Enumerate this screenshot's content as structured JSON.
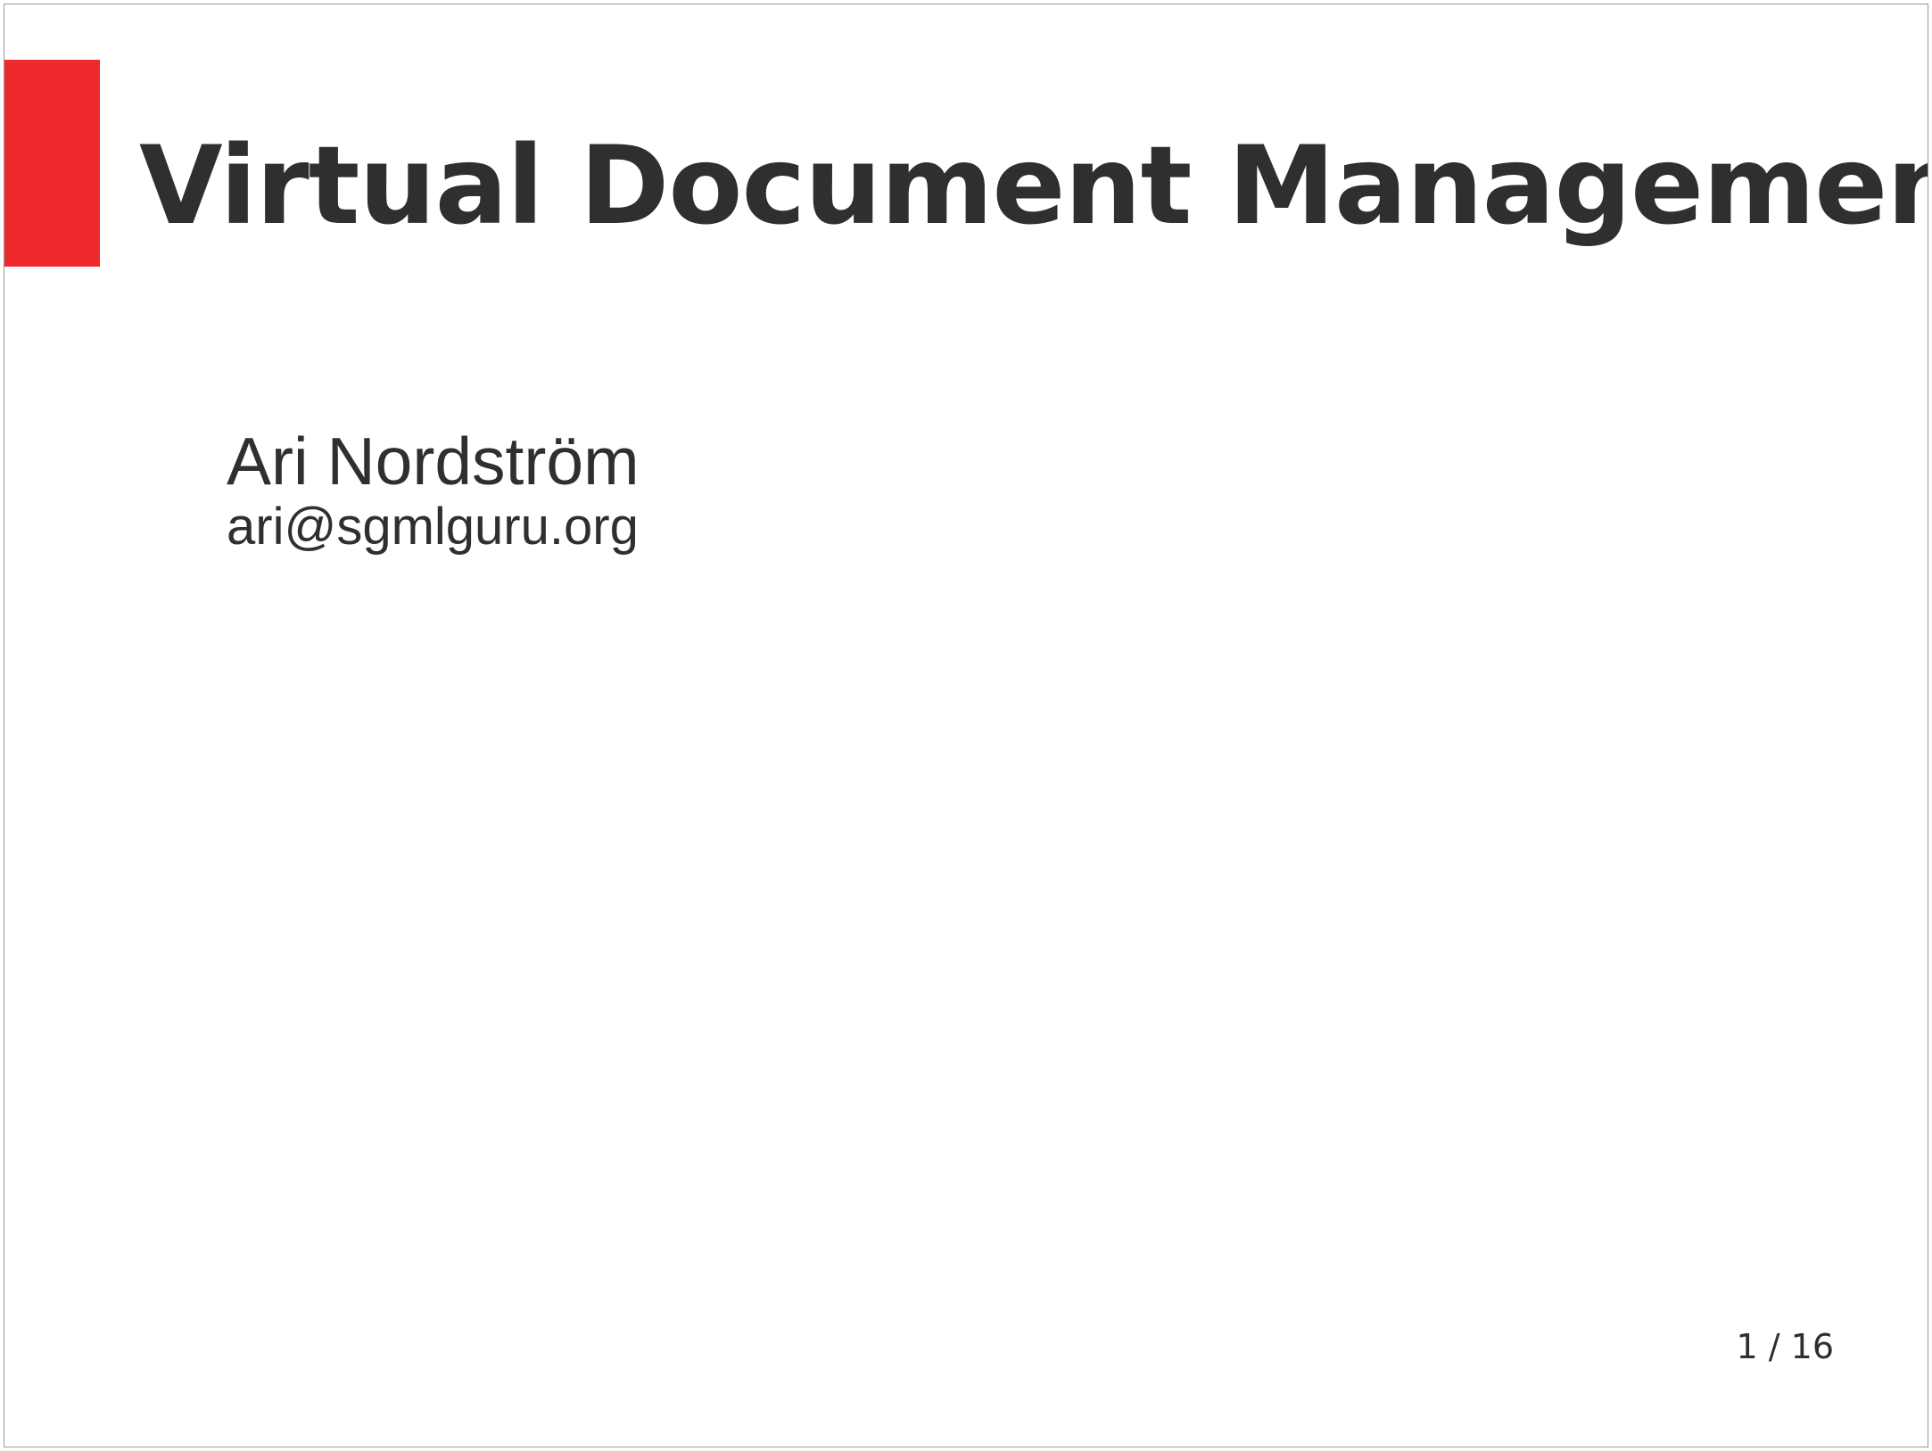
{
  "slide": {
    "title": "Virtual Document Management",
    "author": "Ari Nordström",
    "email": "ari@sgmlguru.org",
    "page_number": "1 / 16"
  },
  "colors": {
    "accent": "#ee2a2c",
    "text": "#2f2f2f",
    "background": "#ffffff"
  }
}
